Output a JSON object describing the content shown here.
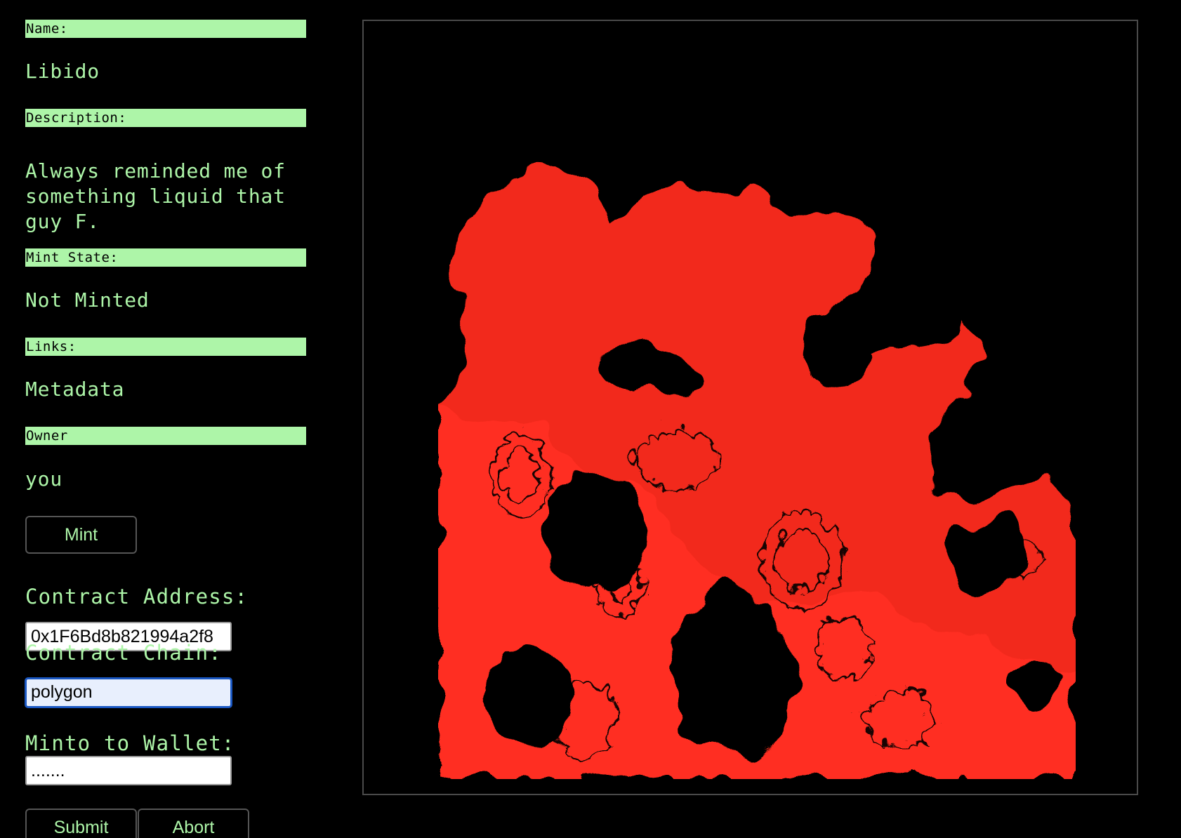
{
  "fields": {
    "name_label": "Name:",
    "name_value": "Libido",
    "description_label": "Description:",
    "description_value": "Always reminded me of something liquid that guy F.",
    "mint_state_label": "Mint State:",
    "mint_state_value": "Not Minted",
    "links_label": "Links:",
    "links_value": "Metadata",
    "owner_label": "Owner",
    "owner_value": "you"
  },
  "buttons": {
    "mint_label": "Mint",
    "submit_label": "Submit",
    "abort_label": "Abort"
  },
  "form": {
    "contract_address_label": "Contract Address:",
    "contract_address_value": "0x1F6Bd8b821994a2f8",
    "contract_chain_label": "Contract Chain:",
    "contract_chain_value": "polygon",
    "wallet_label": "Minto to Wallet:",
    "wallet_value": "......."
  },
  "colors": {
    "accent": "#adf5a8",
    "background": "#000000",
    "art_red": "#ff2d20"
  }
}
